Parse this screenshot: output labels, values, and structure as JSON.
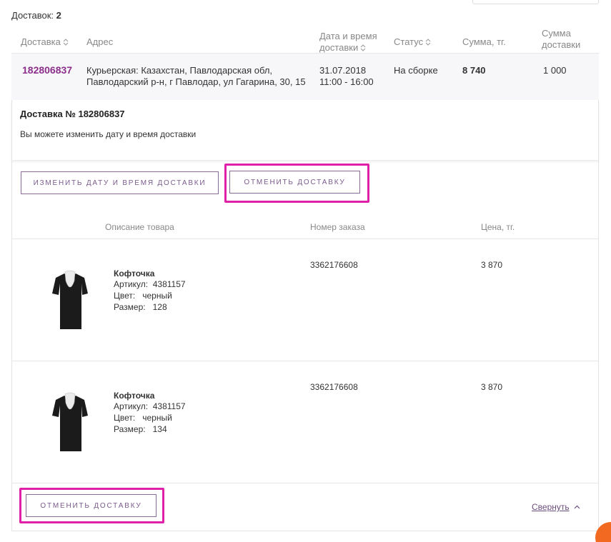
{
  "summary": {
    "label": "Доставок:",
    "count": "2"
  },
  "columns": {
    "delivery": "Доставка",
    "address": "Адрес",
    "datetime_l1": "Дата и время",
    "datetime_l2": "доставки",
    "status": "Статус",
    "sum": "Сумма, тг.",
    "delivery_sum_l1": "Сумма",
    "delivery_sum_l2": "доставки"
  },
  "delivery": {
    "number": "182806837",
    "address_l1": "Курьерская: Казахстан, Павлодарская обл,",
    "address_l2": "Павлодарский р-н, г Павлодар, ул Гагарина, 30, 15",
    "date": "31.07.2018",
    "time": "11:00 - 16:00",
    "status": "На сборке",
    "sum": "8 740",
    "delivery_sum": "1 000"
  },
  "details": {
    "title": "Доставка № 182806837",
    "subtitle": "Вы можете изменить дату и время доставки",
    "change_button": "Изменить дату и время доставки",
    "cancel_button": "Отменить доставку",
    "cancel_button_bottom": "Отменить доставку",
    "collapse_link": "Свернуть"
  },
  "items_columns": {
    "description": "Описание товара",
    "order_number": "Номер заказа",
    "price": "Цена, тг."
  },
  "items": [
    {
      "name": "Кофточка",
      "article_label": "Артикул:",
      "article": "4381157",
      "color_label": "Цвет:",
      "color": "черный",
      "size_label": "Размер:",
      "size": "128",
      "order": "3362176608",
      "price": "3 870"
    },
    {
      "name": "Кофточка",
      "article_label": "Артикул:",
      "article": "4381157",
      "color_label": "Цвет:",
      "color": "черный",
      "size_label": "Размер:",
      "size": "134",
      "order": "3362176608",
      "price": "3 870"
    }
  ],
  "colors": {
    "accent": "#8b2f8b",
    "highlight": "#e020a8",
    "button_border": "#8a6b97",
    "row_bg": "#f7f6f9"
  }
}
